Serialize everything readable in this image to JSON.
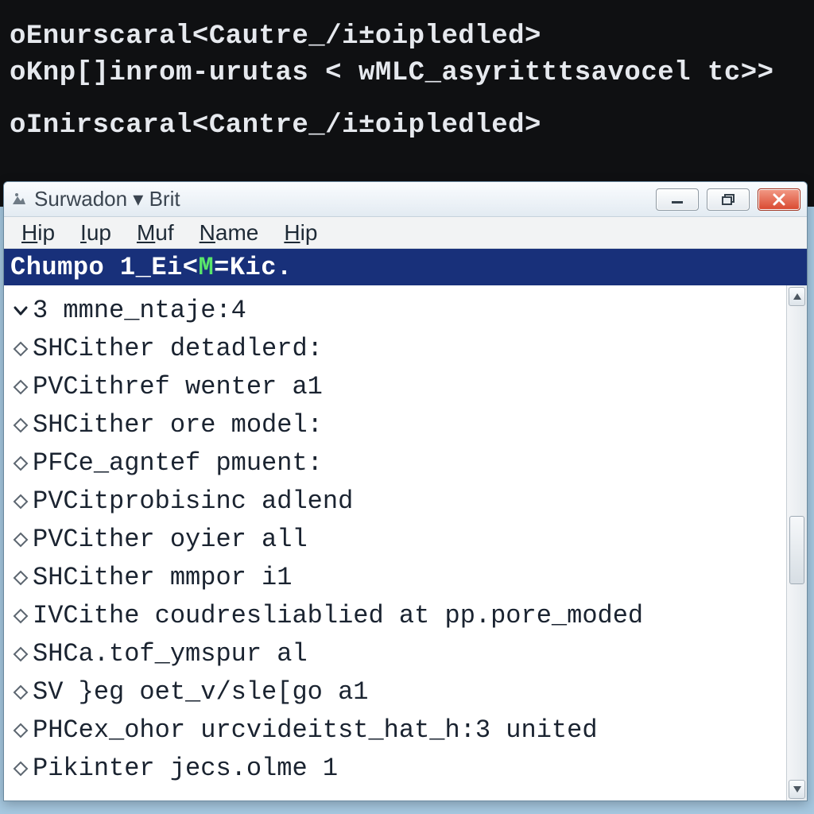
{
  "terminal": {
    "lines": [
      "oEnurscaral<Cautre_/i±oipledled>",
      "oKnp[]inrom-urutas < wMLC_asyritttsavocel tc>>",
      "",
      "oInirscaral<Cantre_/i±oipledled>"
    ]
  },
  "window": {
    "title": "Surwadon ▾ Brit",
    "menu": [
      "Hip",
      "Iup",
      "Muf",
      "Name",
      "Hip"
    ],
    "header": {
      "before": "Chumpo 1_Ei<",
      "highlight": "M",
      "after": "=Kic."
    },
    "rows": [
      {
        "mark": "chevron",
        "text": "3 mmne_ntaje:4"
      },
      {
        "mark": "diamond",
        "text": "SHCither detadlerd:"
      },
      {
        "mark": "diamond",
        "text": "PVCithref wenter a1"
      },
      {
        "mark": "diamond",
        "text": "SHCither ore model:"
      },
      {
        "mark": "diamond",
        "text": "PFCe_agntef pmuent:"
      },
      {
        "mark": "diamond",
        "text": "PVCitprobisinc adlend"
      },
      {
        "mark": "diamond",
        "text": "PVCither oyier all"
      },
      {
        "mark": "diamond",
        "text": "SHCither mmpor i1"
      },
      {
        "mark": "diamond",
        "text": "IVCithe coudresliablied at pp.pore_moded"
      },
      {
        "mark": "diamond",
        "text": "SHCa.tof_ymspur al"
      },
      {
        "mark": "diamond",
        "text": "SV }eg oet_v/sle[go a1"
      },
      {
        "mark": "diamond",
        "text": "PHCex_ohor urcvideitst_hat_h:3 united"
      },
      {
        "mark": "diamond",
        "text": "Pikinter jecs.olme 1"
      }
    ]
  }
}
